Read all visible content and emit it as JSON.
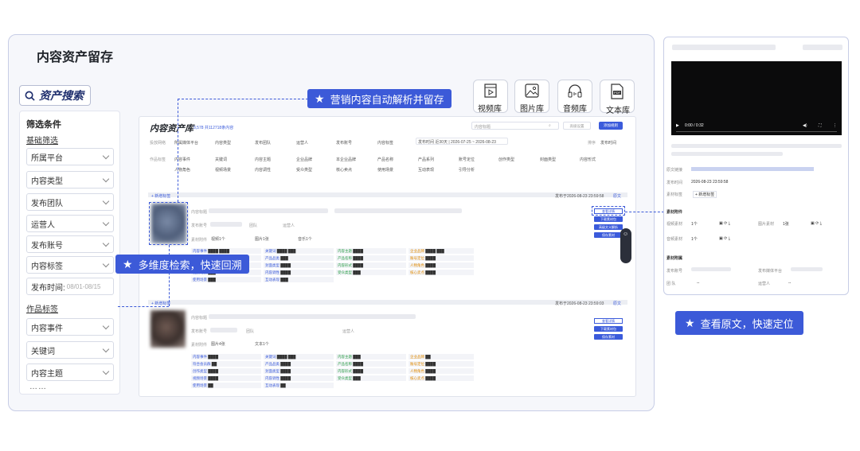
{
  "page_title": "内容资产留存",
  "search_title": "资产搜索",
  "filter": {
    "heading": "筛选条件",
    "basic_label": "基础筛选",
    "basic_items": [
      "所属平台",
      "内容类型",
      "发布团队",
      "运营人",
      "发布账号",
      "内容标签"
    ],
    "publish_time_label": "发布时间:",
    "publish_time_placeholder": "08/01-08/15",
    "works_label": "作品标签",
    "works_items": [
      "内容事件",
      "关键词",
      "内容主题"
    ],
    "more": "……"
  },
  "libraries": [
    "视频库",
    "图片库",
    "音频库",
    "文本库"
  ],
  "callouts": {
    "top": "营销内容自动解析并留存",
    "left": "多维度检索，快速回溯",
    "right": "查看原文，快速定位"
  },
  "main": {
    "title": "内容资产库",
    "count_text": "3,578 共112718条内容",
    "search_placeholder": "内容标题",
    "btn_filter": "高级设置",
    "btn_add": "添加规则",
    "row1": [
      "投放网络",
      "所属媒体平台",
      "内容类型",
      "发布团队",
      "运营人",
      "发布账号",
      "内容标签",
      "发布时间 近30天 | 2026-07-25 ~ 2026-08-23"
    ],
    "row1_right": [
      "排序",
      "发布时间"
    ],
    "row2": [
      "作品标签",
      "内容事件",
      "关键词",
      "内容主题",
      "企业品牌",
      "本企业品牌",
      "产品名称",
      "产品系列",
      "账号定位",
      "创作类型",
      "封面类型",
      "内容形式"
    ],
    "row3": [
      "人物角色",
      "视频场景",
      "内容调性",
      "受众类型",
      "核心卖点",
      "使用场景",
      "互动表现",
      "引导分析"
    ],
    "item1": {
      "tag": "+ 新增标签",
      "time": "发布于2026-08-23 23:59:58",
      "open": "原文",
      "labels": {
        "title": "内容标题",
        "account": "发布账号",
        "team": "团队",
        "operator": "运营人",
        "assets": "素材附件"
      },
      "assets": [
        "视频1个",
        "图片1张",
        "音乐1个"
      ],
      "buttons": [
        "查看详情",
        "下载素材包",
        "高级文义解析",
        "保存素材"
      ]
    },
    "item2": {
      "tag": "+ 新增标签",
      "time": "发布于2026-08-23 23:59:03",
      "open": "原文",
      "labels": {
        "title": "内容标题",
        "account": "发布账号",
        "team": "团队",
        "operator": "运营人",
        "assets": "素材附件"
      },
      "assets": [
        "图片4张",
        "文本1个"
      ],
      "buttons": [
        "查看详情",
        "下载素材包",
        "保存素材"
      ]
    }
  },
  "detail": {
    "player_time": "0:00 / 0:32",
    "source_link_label": "原文链接",
    "publish_time_label": "发布时间",
    "publish_time": "2026-08-23 23:59:58",
    "tag_label": "素材标签",
    "tag_value": "+ 新增标签",
    "section_assets": "素材附件",
    "video_assets_label": "视频素材",
    "video_assets_count": "1个",
    "image_assets_label": "图片素材",
    "image_assets_count": "1张",
    "audio_assets_label": "音频素材",
    "audio_assets_count": "1个",
    "section_info": "素材附属",
    "account_label": "发布账号",
    "platform_label": "发布媒体平台",
    "team_label": "团  队",
    "team_value": "--",
    "operator_label": "运营人",
    "operator_value": "--"
  },
  "colors": {
    "accent": "#3c5ad8",
    "frame": "#c7cde6"
  }
}
